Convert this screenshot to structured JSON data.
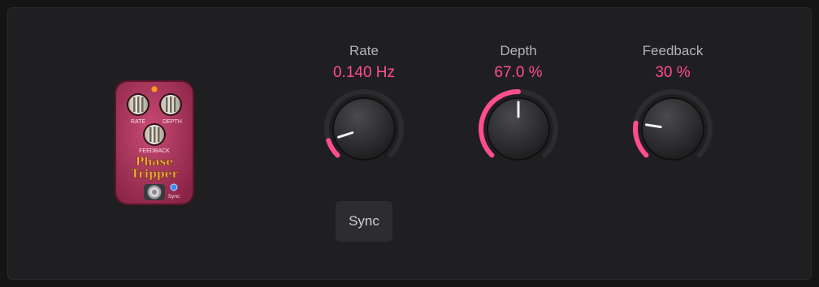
{
  "knobs": [
    {
      "id": "rate",
      "label": "Rate",
      "value": "0.140 Hz",
      "fraction": 0.1
    },
    {
      "id": "depth",
      "label": "Depth",
      "value": "67.0 %",
      "fraction": 0.5
    },
    {
      "id": "feedback",
      "label": "Feedback",
      "value": "30 %",
      "fraction": 0.2
    }
  ],
  "sync_button": {
    "label": "Sync"
  },
  "pedal": {
    "knob_labels": [
      "RATE",
      "DEPTH",
      "FEEDBACK"
    ],
    "logo_line1": "Phase",
    "logo_line2": "Tripper",
    "sync_label": "Sync"
  },
  "colors": {
    "accent": "#ff4d8d",
    "value_text": "#ff4d8d",
    "pedal_body": "#b0345e",
    "led_orange": "#ff9a1a",
    "led_blue": "#3a8cff"
  }
}
